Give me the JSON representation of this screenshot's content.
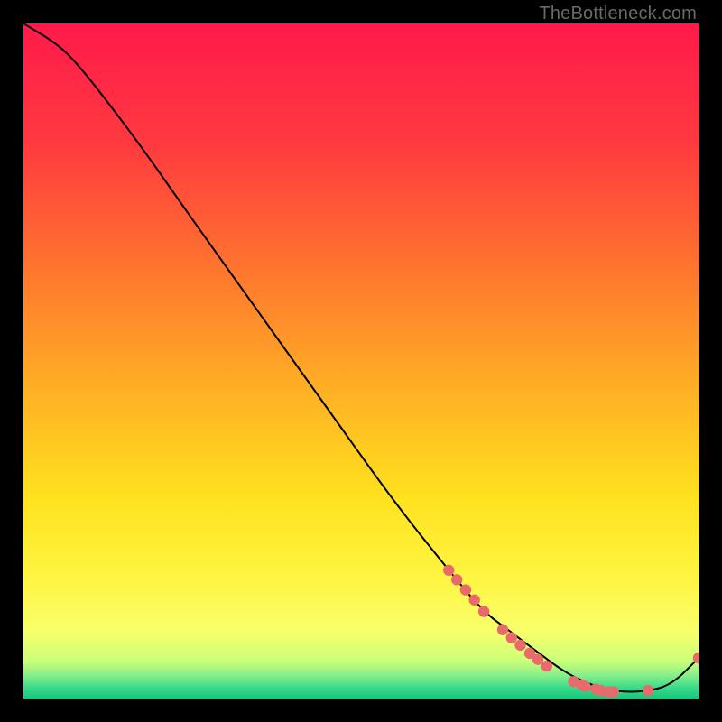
{
  "watermark": "TheBottleneck.com",
  "chart_data": {
    "type": "line",
    "title": "",
    "xlabel": "",
    "ylabel": "",
    "xlim": [
      0,
      100
    ],
    "ylim": [
      0,
      100
    ],
    "gradient_stops": [
      {
        "offset": 0.0,
        "color": "#ff1a4b"
      },
      {
        "offset": 0.18,
        "color": "#ff3a3f"
      },
      {
        "offset": 0.38,
        "color": "#ff7a2d"
      },
      {
        "offset": 0.55,
        "color": "#ffb224"
      },
      {
        "offset": 0.7,
        "color": "#ffe11e"
      },
      {
        "offset": 0.82,
        "color": "#fff542"
      },
      {
        "offset": 0.9,
        "color": "#f8ff6a"
      },
      {
        "offset": 0.945,
        "color": "#caff7a"
      },
      {
        "offset": 0.965,
        "color": "#8af08a"
      },
      {
        "offset": 0.985,
        "color": "#36d98b"
      },
      {
        "offset": 1.0,
        "color": "#18c77a"
      }
    ],
    "series": [
      {
        "name": "bottleneck-curve",
        "x": [
          0,
          5,
          8,
          12,
          18,
          25,
          35,
          45,
          55,
          63,
          68,
          72,
          76,
          80,
          84,
          88,
          92,
          96,
          100
        ],
        "y": [
          100,
          97,
          94,
          89,
          81,
          71,
          57,
          43,
          29,
          19,
          13,
          10,
          7,
          4,
          2,
          1,
          1,
          2,
          6
        ]
      }
    ],
    "markers": {
      "name": "highlight-points",
      "color": "#e96a6a",
      "radius": 6.2,
      "points": [
        {
          "x": 63.0,
          "y": 19.0
        },
        {
          "x": 64.2,
          "y": 17.6
        },
        {
          "x": 65.5,
          "y": 16.1
        },
        {
          "x": 66.8,
          "y": 14.6
        },
        {
          "x": 68.2,
          "y": 12.9
        },
        {
          "x": 71.0,
          "y": 10.2
        },
        {
          "x": 72.3,
          "y": 9.0
        },
        {
          "x": 73.6,
          "y": 7.9
        },
        {
          "x": 75.0,
          "y": 6.7
        },
        {
          "x": 76.2,
          "y": 5.8
        },
        {
          "x": 77.5,
          "y": 4.8
        },
        {
          "x": 81.5,
          "y": 2.5
        },
        {
          "x": 82.7,
          "y": 2.0
        },
        {
          "x": 83.2,
          "y": 1.8
        },
        {
          "x": 84.8,
          "y": 1.4
        },
        {
          "x": 85.5,
          "y": 1.2
        },
        {
          "x": 86.7,
          "y": 1.0
        },
        {
          "x": 87.4,
          "y": 1.0
        },
        {
          "x": 92.5,
          "y": 1.2
        },
        {
          "x": 100.0,
          "y": 6.0
        }
      ]
    }
  }
}
